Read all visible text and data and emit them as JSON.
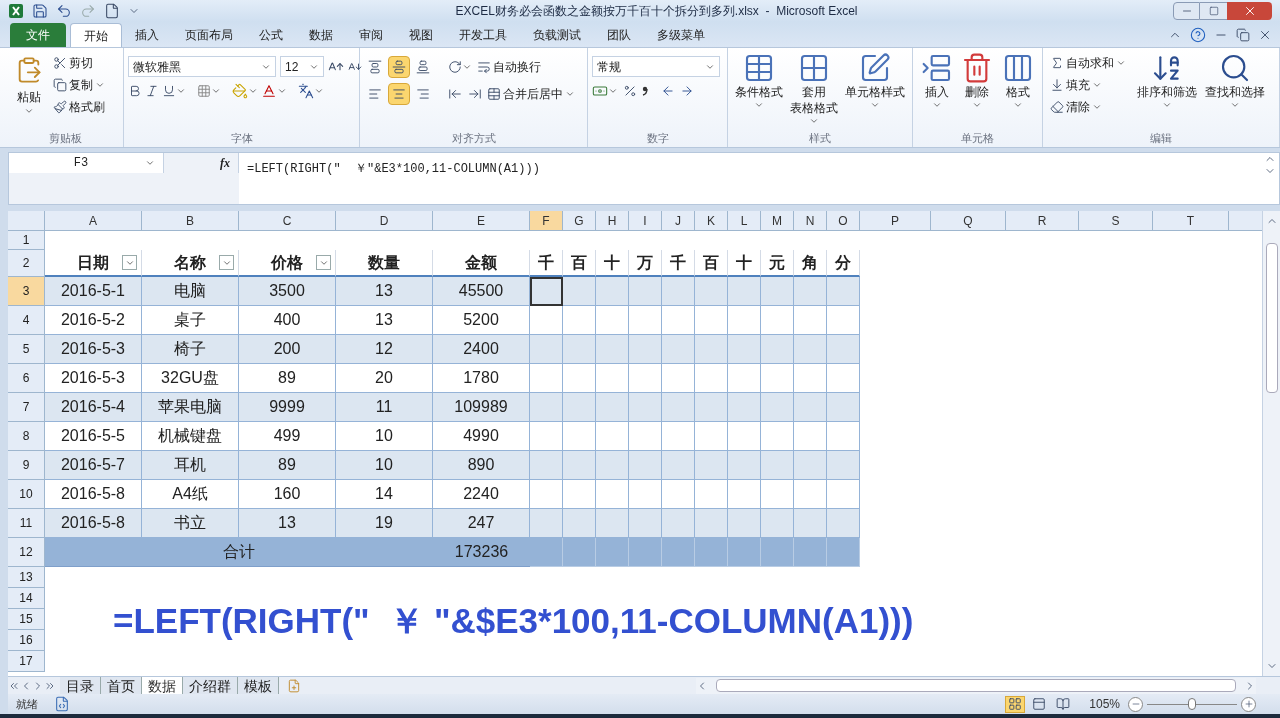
{
  "window": {
    "title": "EXCEL财务必会函数之金额按万千百十个拆分到多列.xlsx  -  Microsoft Excel"
  },
  "ribbon_tabs": [
    {
      "label": "文件",
      "kind": "file",
      "selected": false
    },
    {
      "label": "开始",
      "kind": "tab",
      "selected": true
    },
    {
      "label": "插入",
      "kind": "tab",
      "selected": false
    },
    {
      "label": "页面布局",
      "kind": "tab",
      "selected": false
    },
    {
      "label": "公式",
      "kind": "tab",
      "selected": false
    },
    {
      "label": "数据",
      "kind": "tab",
      "selected": false
    },
    {
      "label": "审阅",
      "kind": "tab",
      "selected": false
    },
    {
      "label": "视图",
      "kind": "tab",
      "selected": false
    },
    {
      "label": "开发工具",
      "kind": "tab",
      "selected": false
    },
    {
      "label": "负载测试",
      "kind": "tab",
      "selected": false
    },
    {
      "label": "团队",
      "kind": "tab",
      "selected": false
    },
    {
      "label": "多级菜单",
      "kind": "tab",
      "selected": false
    }
  ],
  "ribbon": {
    "clipboard": {
      "label": "剪贴板",
      "paste": "粘贴",
      "items": [
        {
          "label": "剪切",
          "dropdown": false
        },
        {
          "label": "复制",
          "dropdown": true
        },
        {
          "label": "格式刷",
          "dropdown": false
        }
      ]
    },
    "font": {
      "label": "字体",
      "font_name": "微软雅黑",
      "font_size": "12"
    },
    "alignment": {
      "label": "对齐方式",
      "vertical": [
        {
          "selected": false
        },
        {
          "selected": true
        },
        {
          "selected": false
        }
      ],
      "horizontal": [
        {
          "selected": false
        },
        {
          "selected": true
        },
        {
          "selected": false
        }
      ],
      "wrap": "自动换行",
      "merge": "合并后居中"
    },
    "number": {
      "label": "数字",
      "format": "常规"
    },
    "styles": {
      "label": "样式",
      "buttons": [
        {
          "lines": [
            "条件格式"
          ]
        },
        {
          "lines": [
            "套用",
            "表格格式"
          ]
        },
        {
          "lines": [
            "单元格样式"
          ]
        }
      ]
    },
    "cells": {
      "label": "单元格",
      "buttons": [
        "插入",
        "删除",
        "格式"
      ]
    },
    "editing": {
      "label": "编辑",
      "items": [
        "自动求和",
        "填充",
        "清除"
      ],
      "buttons": [
        "排序和筛选",
        "查找和选择"
      ]
    }
  },
  "formula_bar": {
    "name_box": "F3",
    "function_button": "fx",
    "formula": "=LEFT(RIGHT(\"  ￥\"&E3*100,11-COLUMN(A1)))"
  },
  "sheet": {
    "columns": [
      {
        "label": "A",
        "selected": false
      },
      {
        "label": "B",
        "selected": false
      },
      {
        "label": "C",
        "selected": false
      },
      {
        "label": "D",
        "selected": false
      },
      {
        "label": "E",
        "selected": false
      },
      {
        "label": "F",
        "selected": true
      },
      {
        "label": "G",
        "selected": false
      },
      {
        "label": "H",
        "selected": false
      },
      {
        "label": "I",
        "selected": false
      },
      {
        "label": "J",
        "selected": false
      },
      {
        "label": "K",
        "selected": false
      },
      {
        "label": "L",
        "selected": false
      },
      {
        "label": "M",
        "selected": false
      },
      {
        "label": "N",
        "selected": false
      },
      {
        "label": "O",
        "selected": false
      },
      {
        "label": "P",
        "selected": false
      },
      {
        "label": "Q",
        "selected": false
      },
      {
        "label": "R",
        "selected": false
      },
      {
        "label": "S",
        "selected": false
      },
      {
        "label": "T",
        "selected": false
      }
    ],
    "rows": [
      {
        "label": "1",
        "selected": false
      },
      {
        "label": "2",
        "selected": false
      },
      {
        "label": "3",
        "selected": true
      },
      {
        "label": "4",
        "selected": false
      },
      {
        "label": "5",
        "selected": false
      },
      {
        "label": "6",
        "selected": false
      },
      {
        "label": "7",
        "selected": false
      },
      {
        "label": "8",
        "selected": false
      },
      {
        "label": "9",
        "selected": false
      },
      {
        "label": "10",
        "selected": false
      },
      {
        "label": "11",
        "selected": false
      },
      {
        "label": "12",
        "selected": false
      },
      {
        "label": "13",
        "selected": false
      },
      {
        "label": "14",
        "selected": false
      },
      {
        "label": "15",
        "selected": false
      },
      {
        "label": "16",
        "selected": false
      },
      {
        "label": "17",
        "selected": false
      }
    ],
    "table": {
      "header": [
        {
          "text": "日期",
          "filter": true
        },
        {
          "text": "名称",
          "filter": true
        },
        {
          "text": "价格",
          "filter": true
        },
        {
          "text": "数量",
          "filter": false
        },
        {
          "text": "金额",
          "filter": false
        },
        {
          "text": "千",
          "filter": false
        },
        {
          "text": "百",
          "filter": false
        },
        {
          "text": "十",
          "filter": false
        },
        {
          "text": "万",
          "filter": false
        },
        {
          "text": "千",
          "filter": false
        },
        {
          "text": "百",
          "filter": false
        },
        {
          "text": "十",
          "filter": false
        },
        {
          "text": "元",
          "filter": false
        },
        {
          "text": "角",
          "filter": false
        },
        {
          "text": "分",
          "filter": false
        }
      ],
      "rows": [
        [
          "2016-5-1",
          "电脑",
          "3500",
          "13",
          "45500"
        ],
        [
          "2016-5-2",
          "桌子",
          "400",
          "13",
          "5200"
        ],
        [
          "2016-5-3",
          "椅子",
          "200",
          "12",
          "2400"
        ],
        [
          "2016-5-3",
          "32GU盘",
          "89",
          "20",
          "1780"
        ],
        [
          "2016-5-4",
          "苹果电脑",
          "9999",
          "11",
          "109989"
        ],
        [
          "2016-5-5",
          "机械键盘",
          "499",
          "10",
          "4990"
        ],
        [
          "2016-5-7",
          "耳机",
          "89",
          "10",
          "890"
        ],
        [
          "2016-5-8",
          "A4纸",
          "160",
          "14",
          "2240"
        ],
        [
          "2016-5-8",
          "书立",
          "13",
          "19",
          "247"
        ]
      ],
      "total": {
        "label": "合计",
        "amount": "173236"
      }
    }
  },
  "caption": "=LEFT(RIGHT(\"  ￥ \"&$E3*100,11-COLUMN(A1)))",
  "sheet_tabs": [
    {
      "label": "目录",
      "selected": false
    },
    {
      "label": "首页",
      "selected": false
    },
    {
      "label": "数据",
      "selected": true
    },
    {
      "label": "介绍群",
      "selected": false
    },
    {
      "label": "模板",
      "selected": false
    }
  ],
  "status_bar": {
    "status": "就绪",
    "views": [
      {
        "selected": true
      },
      {
        "selected": false
      },
      {
        "selected": false
      }
    ],
    "zoom": "105%",
    "zoom_slider": {
      "level": 0.5
    }
  }
}
